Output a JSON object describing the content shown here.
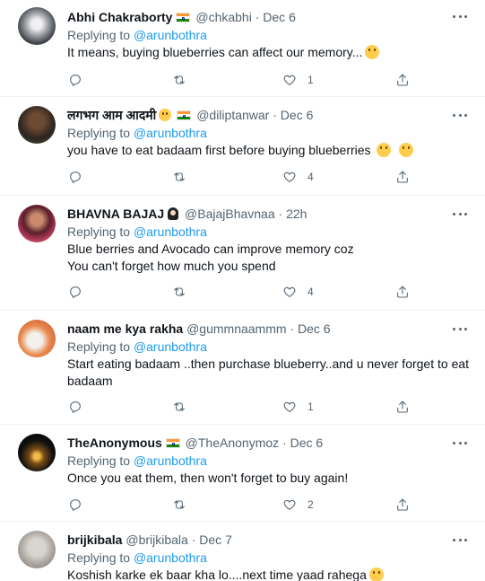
{
  "tweets": [
    {
      "name": "Abhi Chakraborty",
      "has_flag": true,
      "emoji": "",
      "handle": "@chkabhi",
      "sep": "·",
      "time": "Dec 6",
      "replying_prefix": "Replying to",
      "replying_to": "@arunbothra",
      "lines": [
        "It means, buying blueberries can affect our memory..."
      ],
      "trailing_emoji": "zany-face",
      "likes": "1",
      "retweets": ""
    },
    {
      "name": "लगभग आम आदमी",
      "has_flag": true,
      "emoji": "baby-face",
      "handle": "@diliptanwar",
      "sep": "·",
      "time": "Dec 6",
      "replying_prefix": "Replying to",
      "replying_to": "@arunbothra",
      "lines": [
        "you have to eat badaam first before buying blueberries"
      ],
      "trailing_emoji": "two-smiles",
      "likes": "4",
      "retweets": ""
    },
    {
      "name": "BHAVNA BAJAJ",
      "has_flag": false,
      "emoji": "woman-icon",
      "handle": "@BajajBhavnaa",
      "sep": "·",
      "time": "22h",
      "replying_prefix": "Replying to",
      "replying_to": "@arunbothra",
      "lines": [
        "Blue berries and Avocado can improve memory coz",
        "You can't forget how much you spend"
      ],
      "trailing_emoji": "",
      "likes": "4",
      "retweets": ""
    },
    {
      "name": "naam me kya rakha",
      "has_flag": false,
      "emoji": "",
      "handle": "@gummnaammm",
      "sep": "·",
      "time": "Dec 6",
      "replying_prefix": "Replying to",
      "replying_to": "@arunbothra",
      "lines": [
        "Start eating badaam ..then purchase blueberry..and u never forget to eat",
        "badaam"
      ],
      "trailing_emoji": "",
      "likes": "1",
      "retweets": ""
    },
    {
      "name": "TheAnonymous",
      "has_flag": true,
      "emoji": "",
      "handle": "@TheAnonymoz",
      "sep": "·",
      "time": "Dec 6",
      "replying_prefix": "Replying to",
      "replying_to": "@arunbothra",
      "lines": [
        "Once you eat them, then won't forget to buy again!"
      ],
      "trailing_emoji": "",
      "likes": "2",
      "retweets": ""
    },
    {
      "name": "brijkibala",
      "has_flag": false,
      "emoji": "",
      "handle": "@brijkibala",
      "sep": "·",
      "time": "Dec 7",
      "replying_prefix": "Replying to",
      "replying_to": "@arunbothra",
      "lines": [
        "Koshish karke ek baar kha lo....next time yaad rahega"
      ],
      "trailing_emoji": "smile",
      "likes": "",
      "retweets": ""
    }
  ]
}
